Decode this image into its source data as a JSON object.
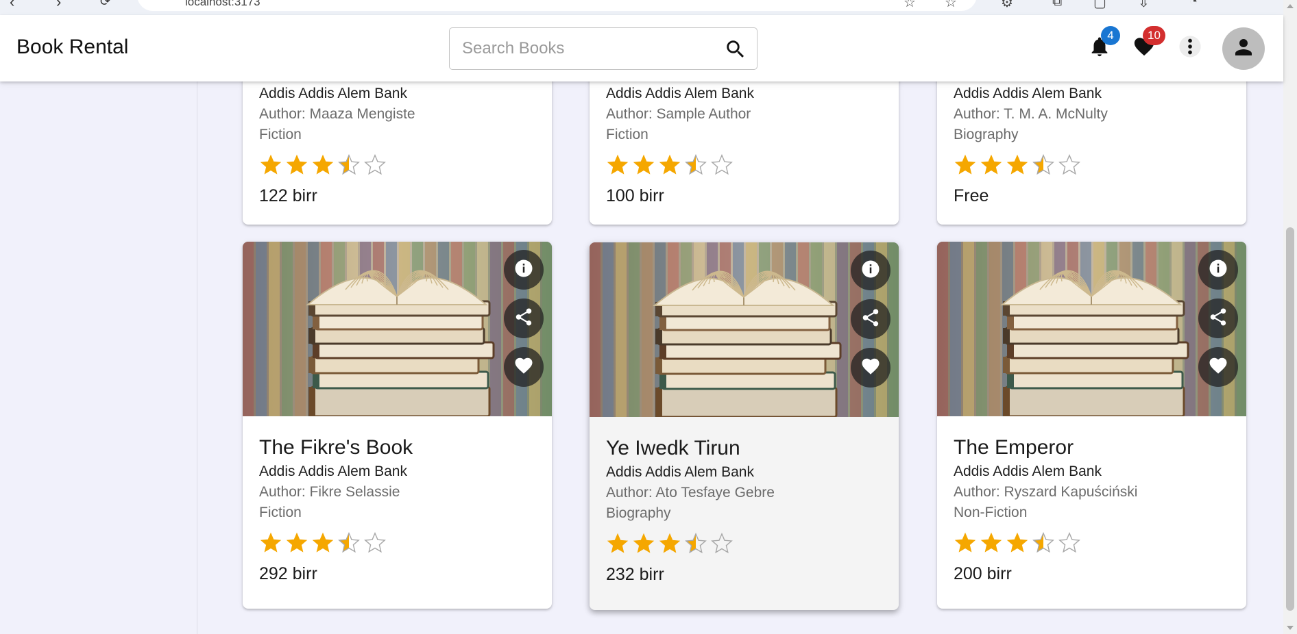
{
  "browser": {
    "url": "localhost:3173"
  },
  "header": {
    "title": "Book Rental",
    "search_placeholder": "Search Books",
    "notifications_count": "4",
    "favorites_count": "10"
  },
  "colors": {
    "star": "#f5a700",
    "notification_badge": "#1976d2",
    "favorites_badge": "#d32f2f"
  },
  "top_cards": [
    {
      "publisher": "Addis Addis Alem Bank",
      "author": "Author: Maaza Mengiste",
      "genre": "Fiction",
      "rating": 3.5,
      "price": "122 birr"
    },
    {
      "publisher": "Addis Addis Alem Bank",
      "author": "Author: Sample Author",
      "genre": "Fiction",
      "rating": 3.5,
      "price": "100 birr"
    },
    {
      "publisher": "Addis Addis Alem Bank",
      "author": "Author: T. M. A. McNulty",
      "genre": "Biography",
      "rating": 3.5,
      "price": "Free"
    }
  ],
  "cards": [
    {
      "title": "The Fikre's Book",
      "publisher": "Addis Addis Alem Bank",
      "author": "Author: Fikre Selassie",
      "genre": "Fiction",
      "rating": 3.5,
      "price": "292 birr"
    },
    {
      "title": "Ye Iwedk Tirun",
      "publisher": "Addis Addis Alem Bank",
      "author": "Author: Ato Tesfaye Gebre",
      "genre": "Biography",
      "rating": 3.5,
      "price": "232 birr"
    },
    {
      "title": "The Emperor",
      "publisher": "Addis Addis Alem Bank",
      "author": "Author: Ryszard Kapuściński",
      "genre": "Non-Fiction",
      "rating": 3.5,
      "price": "200 birr"
    }
  ],
  "icons": {
    "info": "info-icon",
    "share": "share-icon",
    "favorite": "heart-icon",
    "search": "search-icon",
    "notifications": "bell-icon",
    "favorites": "heart-icon",
    "more": "more-vert-icon",
    "account": "person-icon"
  }
}
